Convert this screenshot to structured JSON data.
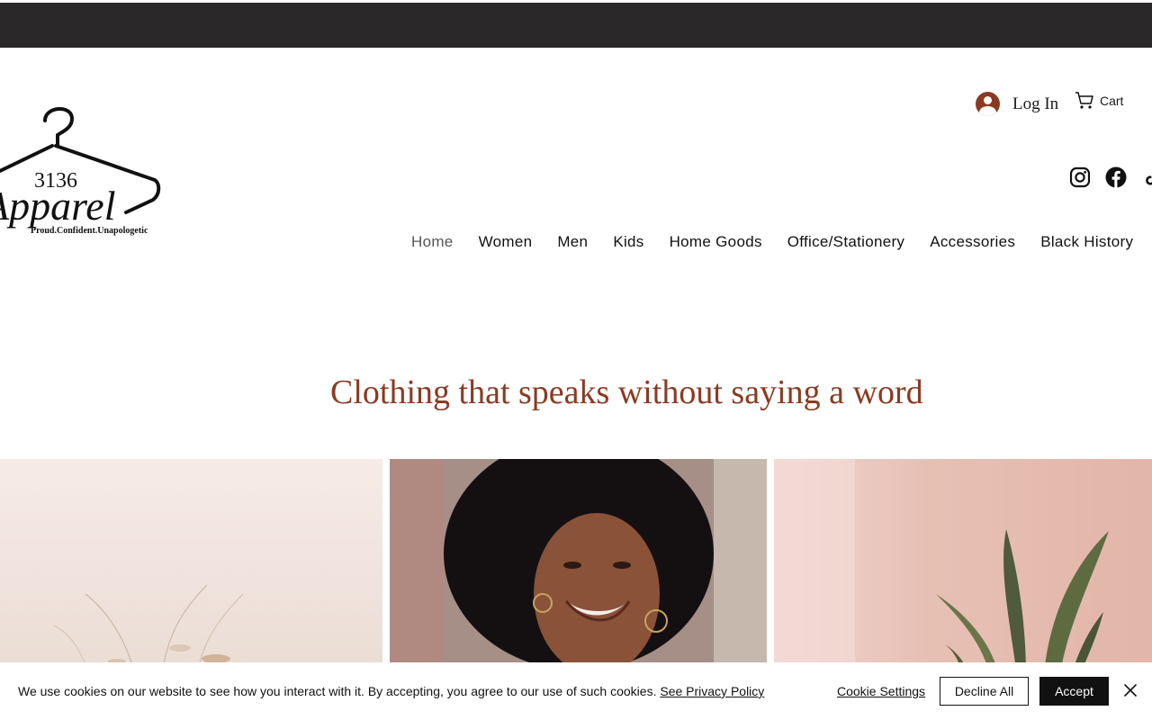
{
  "header": {
    "logo": {
      "text_number": "3136",
      "text_word": "Apparel",
      "tagline": "Proud.Confident.Unapologetic"
    },
    "login_label": "Log In",
    "cart_label": "Cart",
    "social_icons": [
      "instagram-icon",
      "facebook-icon",
      "tiktok-icon"
    ]
  },
  "nav": {
    "items": [
      "Home",
      "Women",
      "Men",
      "Kids",
      "Home Goods",
      "Office/Stationery",
      "Accessories",
      "Black History"
    ],
    "active": "Home"
  },
  "hero": {
    "headline": "Clothing that speaks without saying a word"
  },
  "gallery": {
    "tiles": [
      "dried-grass-photo",
      "smiling-woman-photo",
      "snake-plant-photo"
    ]
  },
  "cookie_banner": {
    "message": "We use cookies on our website to see how you interact with it. By accepting, you agree to our use of such cookies.",
    "privacy_link": "See Privacy Policy",
    "settings_label": "Cookie Settings",
    "decline_label": "Decline All",
    "accept_label": "Accept"
  },
  "colors": {
    "top_bar": "#2a2829",
    "accent": "#8b3a22",
    "text": "#111111"
  }
}
